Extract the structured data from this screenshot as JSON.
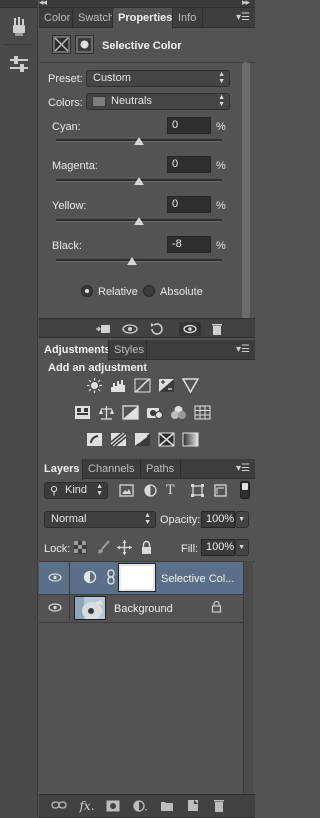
{
  "top_tabs": [
    {
      "label": "Color"
    },
    {
      "label": "Swatche"
    },
    {
      "label": "Properties"
    },
    {
      "label": "Info"
    }
  ],
  "properties": {
    "title": "Selective Color",
    "preset_label": "Preset:",
    "preset_value": "Custom",
    "colors_label": "Colors:",
    "colors_value": "Neutrals",
    "sliders": [
      {
        "label": "Cyan:",
        "value": "0",
        "unit": "%",
        "pos": 0.5
      },
      {
        "label": "Magenta:",
        "value": "0",
        "unit": "%",
        "pos": 0.5
      },
      {
        "label": "Yellow:",
        "value": "0",
        "unit": "%",
        "pos": 0.5
      },
      {
        "label": "Black:",
        "value": "-8",
        "unit": "%",
        "pos": 0.46
      }
    ],
    "method": {
      "relative": "Relative",
      "absolute": "Absolute",
      "selected": "relative"
    }
  },
  "adjustments": {
    "tabs": [
      {
        "label": "Adjustments"
      },
      {
        "label": "Styles"
      }
    ],
    "title": "Add an adjustment"
  },
  "layers": {
    "tabs": [
      {
        "label": "Layers"
      },
      {
        "label": "Channels"
      },
      {
        "label": "Paths"
      }
    ],
    "filter_kind": "Kind",
    "blend_mode": "Normal",
    "opacity_label": "Opacity:",
    "opacity_value": "100%",
    "lock_label": "Lock:",
    "fill_label": "Fill:",
    "fill_value": "100%",
    "items": [
      {
        "name": "Selective Col...",
        "selected": true
      },
      {
        "name": "Background",
        "selected": false
      }
    ]
  },
  "colors": {
    "panel_bg": "#535353",
    "selected_layer_bg": "#5b7088",
    "tab_bar_bg": "#3d3d3d"
  }
}
